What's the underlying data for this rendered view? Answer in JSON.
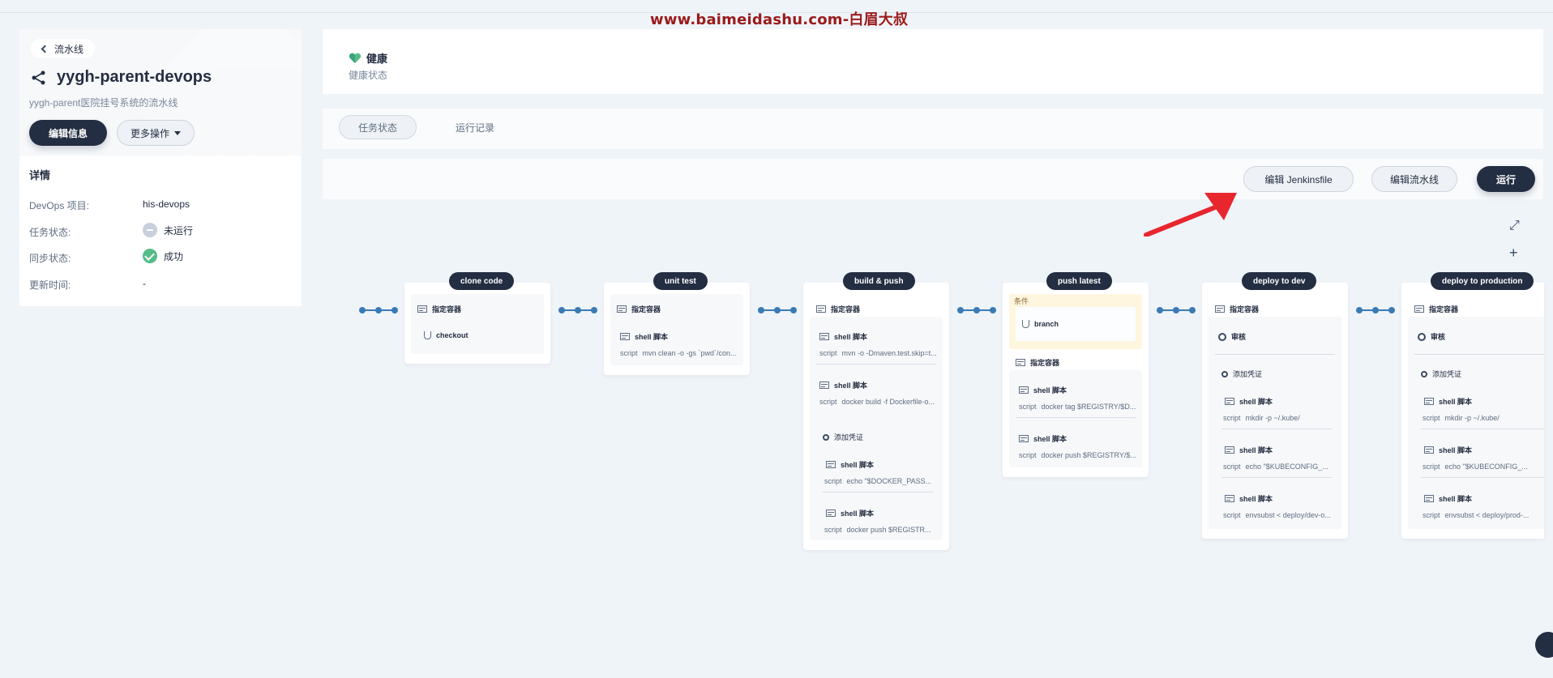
{
  "watermark": "www.baimeidashu.com-白眉大叔",
  "sidebar": {
    "back_label": "流水线",
    "pipeline_name": "yygh-parent-devops",
    "pipeline_desc": "yygh-parent医院挂号系统的流水线",
    "edit_button": "编辑信息",
    "more_button": "更多操作"
  },
  "details": {
    "title": "详情",
    "rows": [
      {
        "label": "DevOps 项目:",
        "value": "his-devops"
      },
      {
        "label": "任务状态:",
        "value": "未运行"
      },
      {
        "label": "同步状态:",
        "value": "成功"
      },
      {
        "label": "更新时间:",
        "value": "-"
      }
    ]
  },
  "health": {
    "title": "健康",
    "subtitle": "健康状态"
  },
  "tabs": [
    {
      "label": "任务状态",
      "active": true
    },
    {
      "label": "运行记录",
      "active": false
    }
  ],
  "toolbar": {
    "edit_jenkinsfile": "编辑 Jenkinsfile",
    "edit_pipeline": "编辑流水线",
    "run": "运行"
  },
  "controls": {
    "expand": "⤢",
    "add": "+"
  },
  "stages": [
    {
      "name": "clone code",
      "steps": [
        {
          "kind": "container",
          "label": "指定容器"
        },
        {
          "kind": "checkout",
          "label": "checkout"
        }
      ]
    },
    {
      "name": "unit test",
      "steps": [
        {
          "kind": "container",
          "label": "指定容器"
        },
        {
          "kind": "shell",
          "label": "shell 脚本",
          "script_label": "script",
          "script": "mvn clean -o -gs `pwd`/con..."
        }
      ]
    },
    {
      "name": "build & push",
      "steps": [
        {
          "kind": "container",
          "label": "指定容器"
        },
        {
          "kind": "shell",
          "label": "shell 脚本",
          "script_label": "script",
          "script": "mvn -o -Dmaven.test.skip=t..."
        },
        {
          "kind": "shell",
          "label": "shell 脚本",
          "script_label": "script",
          "script": "docker build -f Dockerfile-o..."
        },
        {
          "kind": "credential",
          "label": "添加凭证"
        },
        {
          "kind": "shell",
          "label": "shell 脚本",
          "script_label": "script",
          "script": "echo \"$DOCKER_PASS..."
        },
        {
          "kind": "shell",
          "label": "shell 脚本",
          "script_label": "script",
          "script": "docker push $REGISTR..."
        }
      ]
    },
    {
      "name": "push latest",
      "condition_label": "条件",
      "condition": "branch",
      "steps": [
        {
          "kind": "container",
          "label": "指定容器"
        },
        {
          "kind": "shell",
          "label": "shell 脚本",
          "script_label": "script",
          "script": "docker tag $REGISTRY/$D..."
        },
        {
          "kind": "shell",
          "label": "shell 脚本",
          "script_label": "script",
          "script": "docker push $REGISTRY/$..."
        }
      ]
    },
    {
      "name": "deploy to dev",
      "steps": [
        {
          "kind": "container",
          "label": "指定容器"
        },
        {
          "kind": "review",
          "label": "审核"
        },
        {
          "kind": "credential",
          "label": "添加凭证"
        },
        {
          "kind": "shell",
          "label": "shell 脚本",
          "script_label": "script",
          "script": "mkdir -p ~/.kube/"
        },
        {
          "kind": "shell",
          "label": "shell 脚本",
          "script_label": "script",
          "script": "echo \"$KUBECONFIG_..."
        },
        {
          "kind": "shell",
          "label": "shell 脚本",
          "script_label": "script",
          "script": "envsubst < deploy/dev-o..."
        }
      ]
    },
    {
      "name": "deploy to production",
      "steps": [
        {
          "kind": "container",
          "label": "指定容器"
        },
        {
          "kind": "review",
          "label": "审核"
        },
        {
          "kind": "credential",
          "label": "添加凭证"
        },
        {
          "kind": "shell",
          "label": "shell 脚本",
          "script_label": "script",
          "script": "mkdir -p ~/.kube/"
        },
        {
          "kind": "shell",
          "label": "shell 脚本",
          "script_label": "script",
          "script": "echo \"$KUBECONFIG_..."
        },
        {
          "kind": "shell",
          "label": "shell 脚本",
          "script_label": "script",
          "script": "envsubst < deploy/prod-..."
        }
      ]
    }
  ],
  "colors": {
    "dark": "#242e42",
    "accent_blue": "#3a7bb5",
    "success": "#55bc8a",
    "arrow": "#e8262e",
    "watermark": "#9b1a1a"
  }
}
